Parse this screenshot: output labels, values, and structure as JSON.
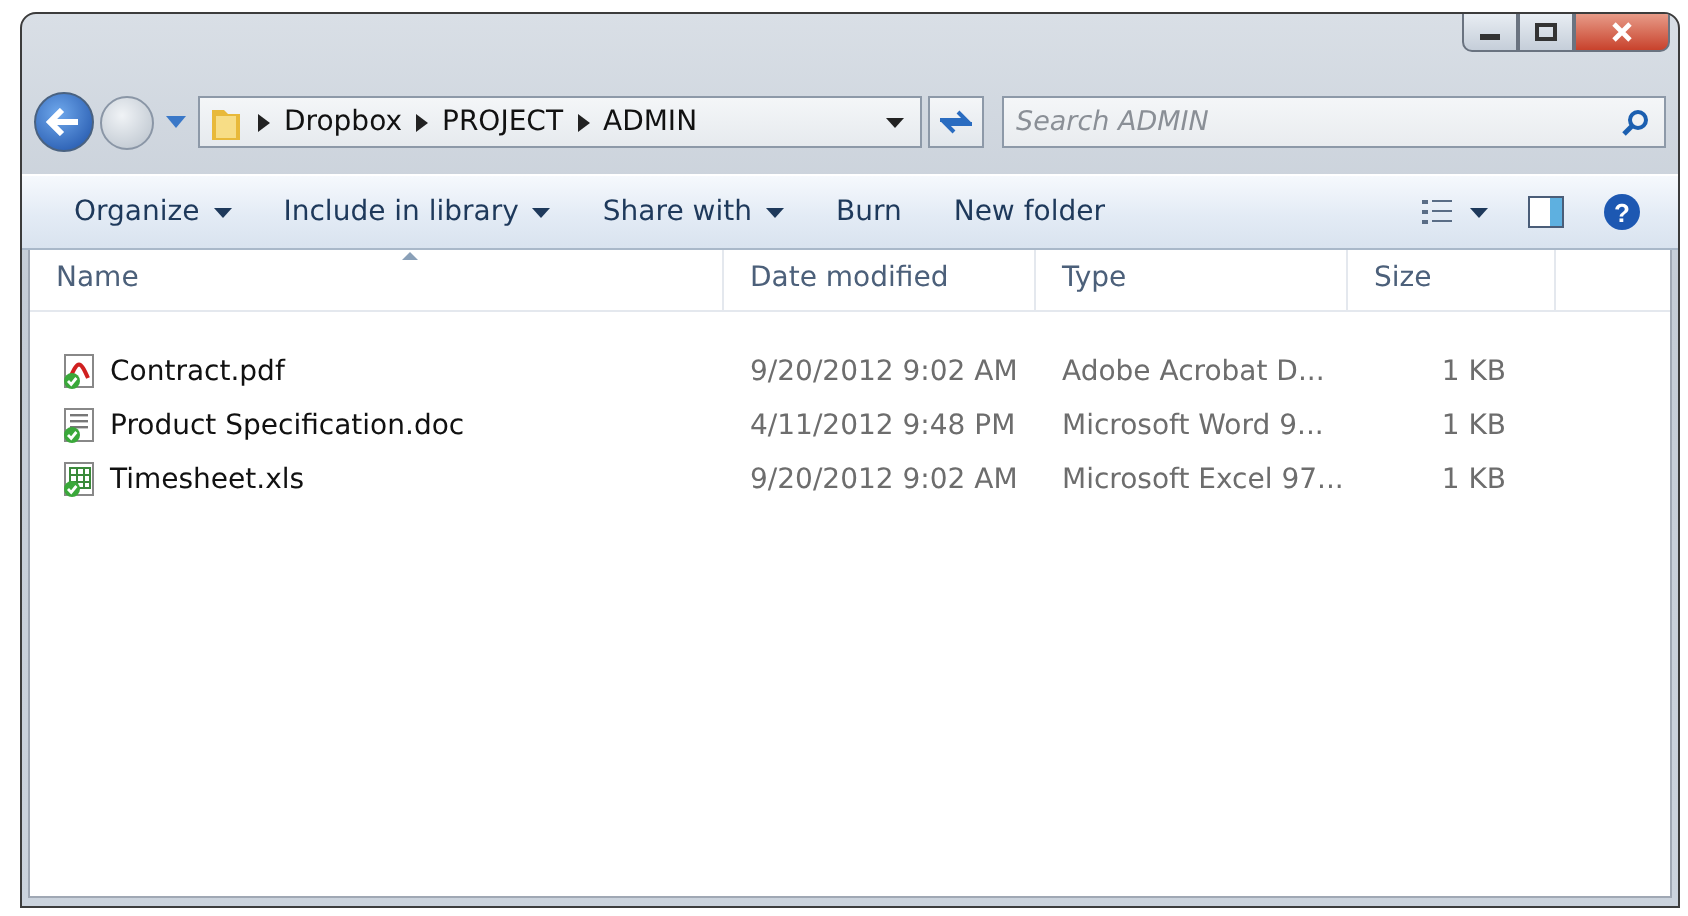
{
  "address": {
    "crumbs": [
      "Dropbox",
      "PROJECT",
      "ADMIN"
    ]
  },
  "search": {
    "placeholder": "Search ADMIN"
  },
  "toolbar": [
    {
      "label": "Organize",
      "menu": true
    },
    {
      "label": "Include in library",
      "menu": true
    },
    {
      "label": "Share with",
      "menu": true
    },
    {
      "label": "Burn",
      "menu": false
    },
    {
      "label": "New folder",
      "menu": false
    }
  ],
  "help": {
    "label": "?"
  },
  "columns": [
    "Name",
    "Date modified",
    "Type",
    "Size"
  ],
  "files": [
    {
      "name": "Contract.pdf",
      "kind": "pdf",
      "date": "9/20/2012 9:02 AM",
      "type": "Adobe Acrobat D...",
      "size": "1 KB"
    },
    {
      "name": "Product Specification.doc",
      "kind": "doc",
      "date": "4/11/2012 9:48 PM",
      "type": "Microsoft Word 9...",
      "size": "1 KB"
    },
    {
      "name": "Timesheet.xls",
      "kind": "xls",
      "date": "9/20/2012 9:02 AM",
      "type": "Microsoft Excel 97...",
      "size": "1 KB"
    }
  ]
}
